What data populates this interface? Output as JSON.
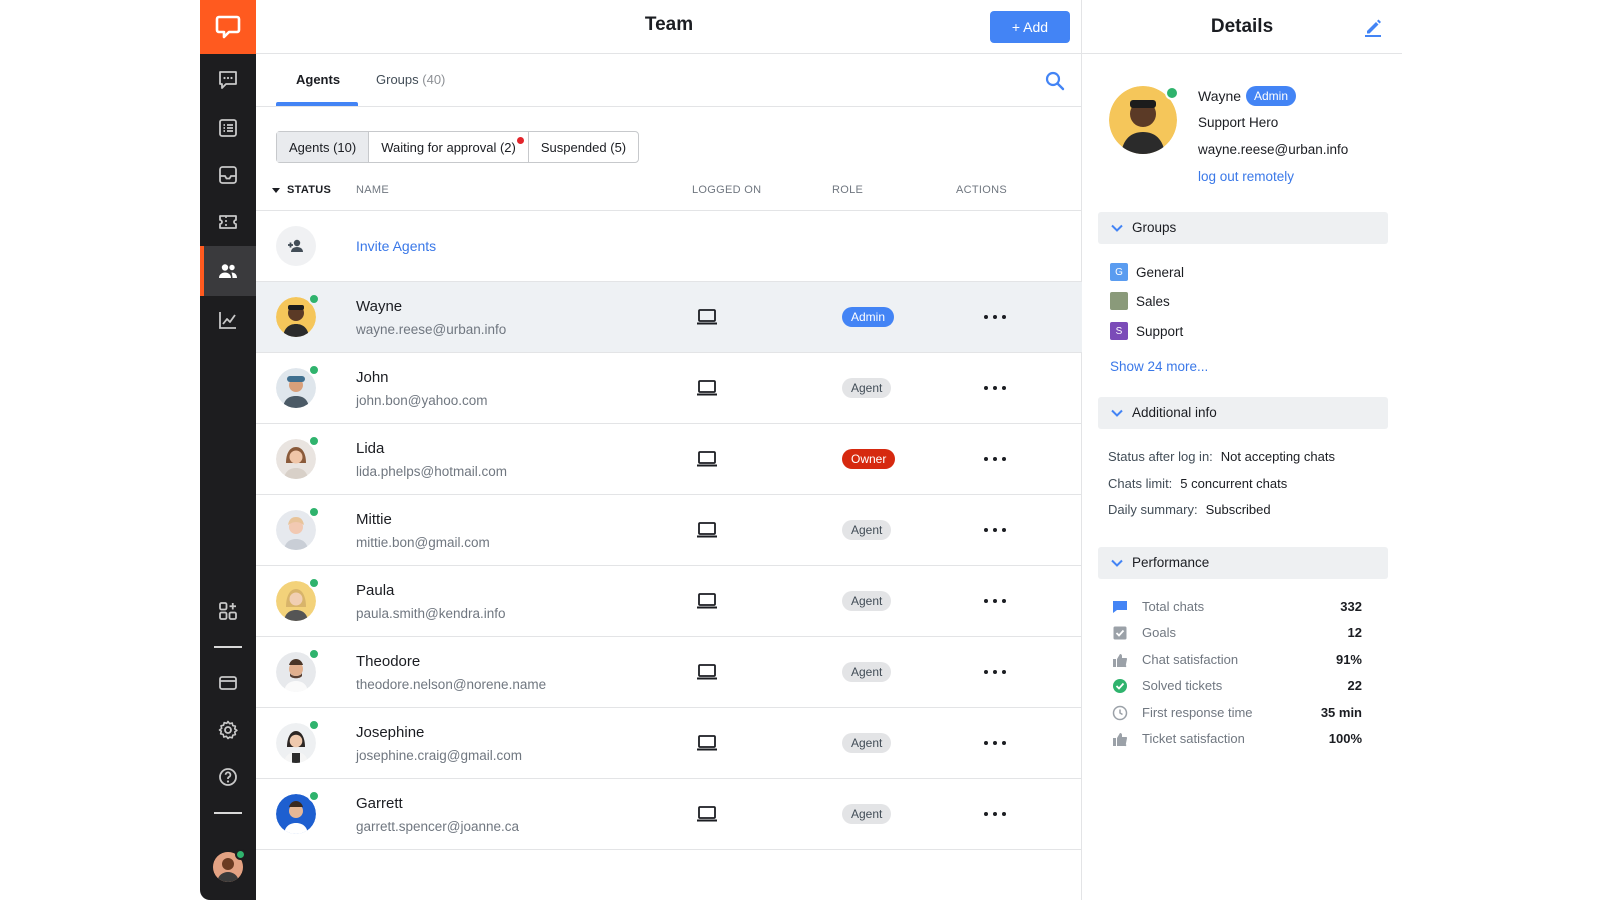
{
  "app": {
    "main_title": "Team",
    "add_button": "+ Add",
    "details_title": "Details"
  },
  "tabs": [
    {
      "label": "Agents",
      "count": ""
    },
    {
      "label": "Groups",
      "count": "(40)"
    }
  ],
  "filters": [
    {
      "label": "Agents (10)"
    },
    {
      "label": "Waiting for approval (2)"
    },
    {
      "label": "Suspended (5)"
    }
  ],
  "columns": {
    "status": "STATUS",
    "name": "NAME",
    "logged_on": "LOGGED ON",
    "role": "ROLE",
    "actions": "ACTIONS"
  },
  "invite": {
    "label": "Invite Agents"
  },
  "agents": [
    {
      "name": "Wayne",
      "email": "wayne.reese@urban.info",
      "role": "Admin"
    },
    {
      "name": "John",
      "email": "john.bon@yahoo.com",
      "role": "Agent"
    },
    {
      "name": "Lida",
      "email": "lida.phelps@hotmail.com",
      "role": "Owner"
    },
    {
      "name": "Mittie",
      "email": "mittie.bon@gmail.com",
      "role": "Agent"
    },
    {
      "name": "Paula",
      "email": "paula.smith@kendra.info",
      "role": "Agent"
    },
    {
      "name": "Theodore",
      "email": "theodore.nelson@norene.name",
      "role": "Agent"
    },
    {
      "name": "Josephine",
      "email": "josephine.craig@gmail.com",
      "role": "Agent"
    },
    {
      "name": "Garrett",
      "email": "garrett.spencer@joanne.ca",
      "role": "Agent"
    }
  ],
  "profile": {
    "name": "Wayne",
    "badge": "Admin",
    "role": "Support Hero",
    "email": "wayne.reese@urban.info",
    "logout": "log out remotely"
  },
  "sections": {
    "groups": "Groups",
    "additional": "Additional info",
    "performance": "Performance"
  },
  "groups": [
    {
      "letter": "G",
      "label": "General",
      "color": "#5a9cf0"
    },
    {
      "letter": "",
      "label": "Sales",
      "color": "#8a9a7a"
    },
    {
      "letter": "S",
      "label": "Support",
      "color": "#7b4bb8"
    }
  ],
  "show_more": "Show 24 more...",
  "additional_info": [
    {
      "key": "Status after log in:",
      "value": "Not accepting chats"
    },
    {
      "key": "Chats limit:",
      "value": "5 concurrent chats"
    },
    {
      "key": "Daily summary:",
      "value": "Subscribed"
    }
  ],
  "performance": [
    {
      "icon": "chat-bubble-icon",
      "label": "Total chats",
      "value": "332"
    },
    {
      "icon": "checkbox-icon",
      "label": "Goals",
      "value": "12"
    },
    {
      "icon": "thumbs-up-icon",
      "label": "Chat satisfaction",
      "value": "91%"
    },
    {
      "icon": "check-circle-icon",
      "label": "Solved tickets",
      "value": "22"
    },
    {
      "icon": "clock-icon",
      "label": "First response time",
      "value": "35 min"
    },
    {
      "icon": "thumbs-up-icon",
      "label": "Ticket satisfaction",
      "value": "100%"
    }
  ],
  "colors": {
    "brand": "#ff5a1f",
    "accent": "#4384f5",
    "online": "#2fb36d",
    "owner": "#d6290f",
    "rail": "#1d1d1f"
  }
}
